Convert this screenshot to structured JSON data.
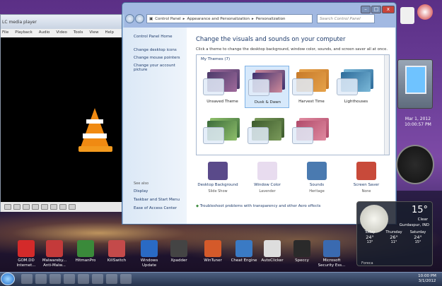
{
  "vlc": {
    "title": "LC media player",
    "menu": [
      "Playback",
      "Audio",
      "Video",
      "Tools",
      "View",
      "Help"
    ],
    "menu_first": "File"
  },
  "window": {
    "breadcrumb": [
      "Control Panel",
      "Appearance and Personalization",
      "Personalization"
    ],
    "search_placeholder": "Search Control Panel",
    "min": "–",
    "max": "□",
    "close": "x"
  },
  "left_links": [
    "Control Panel Home",
    "Change desktop icons",
    "Change mouse pointers",
    "Change your account picture"
  ],
  "see_also": {
    "heading": "See also",
    "links": [
      "Display",
      "Taskbar and Start Menu",
      "Ease of Access Center"
    ]
  },
  "main": {
    "title": "Change the visuals and sounds on your computer",
    "subtitle": "Click a theme to change the desktop background, window color, sounds, and screen saver all at once.",
    "group": "My Themes (7)"
  },
  "themes": [
    {
      "name": "Unsaved Theme",
      "c1": "#4b3a6a",
      "c2": "#a06a9b"
    },
    {
      "name": "Dusk & Dawn",
      "c1": "#3a2f6e",
      "c2": "#d08a9a"
    },
    {
      "name": "Harvest Time",
      "c1": "#c77a2a",
      "c2": "#e6a24a"
    },
    {
      "name": "Lighthouses",
      "c1": "#2d6b9a",
      "c2": "#7ab8d8"
    },
    {
      "name": "",
      "c1": "#3b6b3b",
      "c2": "#8fbf6a"
    },
    {
      "name": "",
      "c1": "#3c5a2c",
      "c2": "#7a9a5a"
    },
    {
      "name": "",
      "c1": "#b04a6a",
      "c2": "#e08aa0"
    }
  ],
  "controls": [
    {
      "name": "Desktop Background",
      "value": "Slide Show",
      "color": "#5a4a8a"
    },
    {
      "name": "Window Color",
      "value": "Lavender",
      "color": "#e8dcef"
    },
    {
      "name": "Sounds",
      "value": "Heritage",
      "color": "#4a7ab0"
    },
    {
      "name": "Screen Saver",
      "value": "None",
      "color": "#c84a3a"
    }
  ],
  "troubleshoot": "Troubleshoot problems with transparency and other Aero effects",
  "desktop_icons": [
    {
      "label": "GOM.DD\nInternet...",
      "color": "#d42a2a"
    },
    {
      "label": "Malwareby...\nAnti-Malw...",
      "color": "#c43a3a"
    },
    {
      "label": "HitmanPro",
      "color": "#3a8a3a"
    },
    {
      "label": "KillSwitch",
      "color": "#c44a4a"
    },
    {
      "label": "Windows\nUpdate",
      "color": "#2a6ac4"
    },
    {
      "label": "Xpadder",
      "color": "#444444"
    },
    {
      "label": "WinTuner",
      "color": "#d45a2a"
    },
    {
      "label": "Cheat Engine",
      "color": "#3a7ac4"
    },
    {
      "label": "AutoClicker",
      "color": "#dddddd"
    },
    {
      "label": "Speccy",
      "color": "#2a2a2a"
    },
    {
      "label": "Microsoft\nSecurity Ess...",
      "color": "#3a6ab0"
    }
  ],
  "gadgets": {
    "date_top": "Mar 1, 2012",
    "date_time": "10:00:57 PM",
    "weather": {
      "temp": "15°",
      "cond": "Clear",
      "loc": "Gurdaspur, IND",
      "forecast": [
        {
          "day": "Today",
          "hi": "24°",
          "lo": "13°"
        },
        {
          "day": "Thursday",
          "hi": "26°",
          "lo": "11°"
        },
        {
          "day": "Saturday",
          "hi": "24°",
          "lo": "15°"
        }
      ],
      "source": "Foreca"
    }
  },
  "tray": {
    "time": "10:00 PM",
    "date": "3/1/2012"
  }
}
